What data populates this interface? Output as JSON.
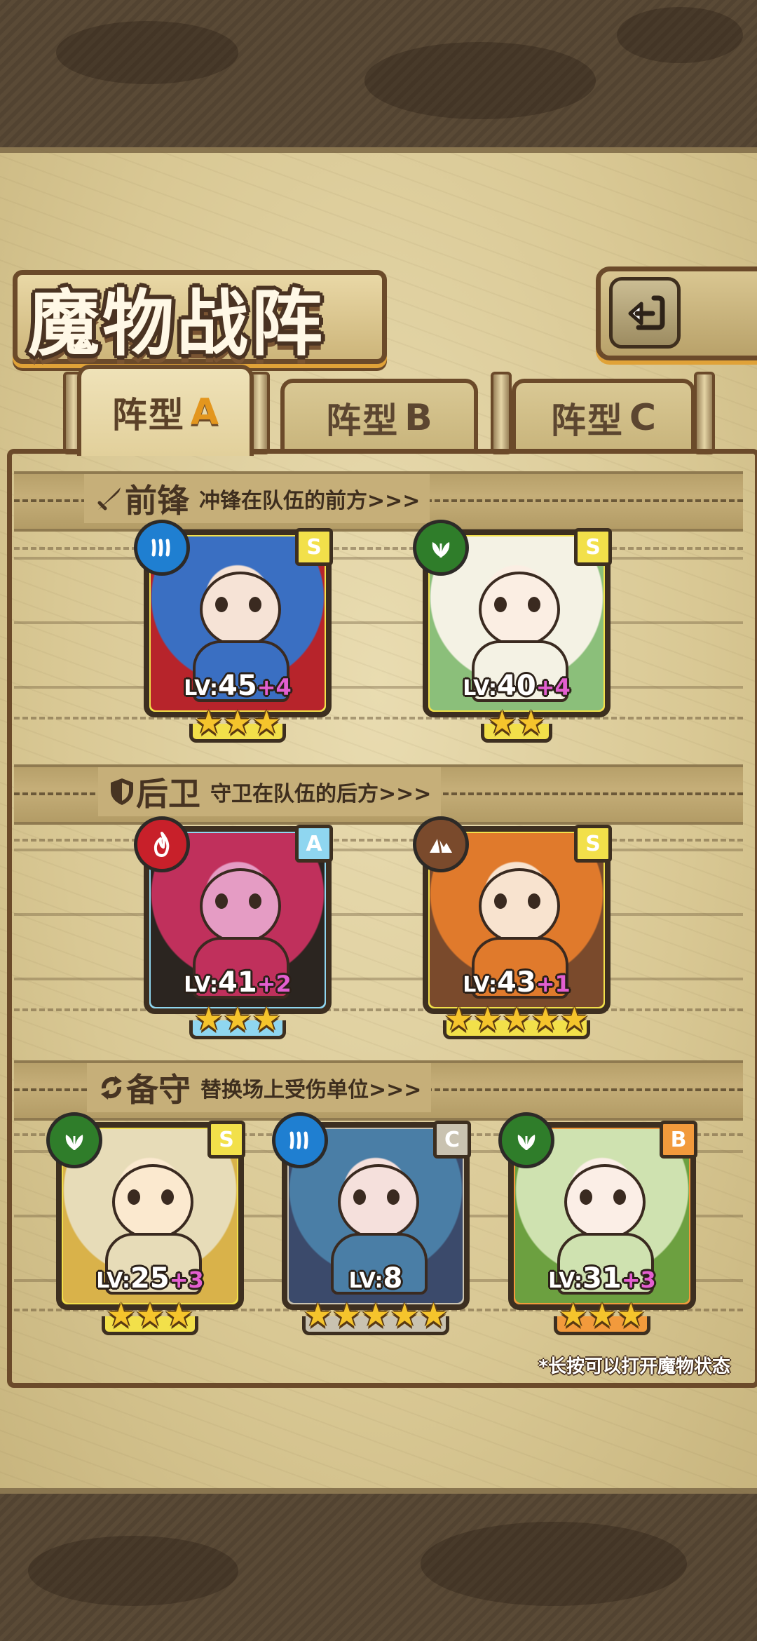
{
  "header": {
    "title": "魔物战阵",
    "back_icon": "return-icon"
  },
  "tabs": [
    {
      "label": "阵型",
      "letter": "A",
      "active": true
    },
    {
      "label": "阵型",
      "letter": "B",
      "active": false
    },
    {
      "label": "阵型",
      "letter": "C",
      "active": false
    }
  ],
  "sections": {
    "front": {
      "icon": "sword-icon",
      "name": "前锋",
      "desc": "冲锋在队伍的前方>>>"
    },
    "back": {
      "icon": "shield-icon",
      "name": "后卫",
      "desc": "守卫在队伍的后方>>>"
    },
    "reserve": {
      "icon": "swap-icon",
      "name": "备守",
      "desc": "替换场上受伤单位>>>"
    }
  },
  "monsters": {
    "front": [
      {
        "element": "water-icon",
        "element_color": "#1f7fd1",
        "rank": "S",
        "frame_color": "#f2e04a",
        "lv_prefix": "LV:",
        "level": "45",
        "bonus": "+4",
        "stars": 3
      },
      {
        "element": "leaf-icon",
        "element_color": "#2f7d2a",
        "rank": "S",
        "frame_color": "#f2e04a",
        "lv_prefix": "LV:",
        "level": "40",
        "bonus": "+4",
        "stars": 2
      }
    ],
    "back": [
      {
        "element": "fire-icon",
        "element_color": "#c8202a",
        "rank": "A",
        "frame_color": "#8fd6f0",
        "lv_prefix": "LV:",
        "level": "41",
        "bonus": "+2",
        "stars": 3
      },
      {
        "element": "mountain-icon",
        "element_color": "#7a4a2c",
        "rank": "S",
        "frame_color": "#f2e04a",
        "lv_prefix": "LV:",
        "level": "43",
        "bonus": "+1",
        "stars": 5
      }
    ],
    "reserve": [
      {
        "element": "leaf-icon",
        "element_color": "#2f7d2a",
        "rank": "S",
        "frame_color": "#f2e04a",
        "lv_prefix": "LV:",
        "level": "25",
        "bonus": "+3",
        "stars": 3
      },
      {
        "element": "water-icon",
        "element_color": "#1f7fd1",
        "rank": "C",
        "frame_color": "#c9c2b0",
        "lv_prefix": "LV:",
        "level": "8",
        "bonus": "",
        "stars": 5
      },
      {
        "element": "leaf-icon",
        "element_color": "#2f7d2a",
        "rank": "B",
        "frame_color": "#f29a3c",
        "lv_prefix": "LV:",
        "level": "31",
        "bonus": "+3",
        "stars": 3
      }
    ]
  },
  "footer": {
    "hint": "*长按可以打开魔物状态"
  }
}
